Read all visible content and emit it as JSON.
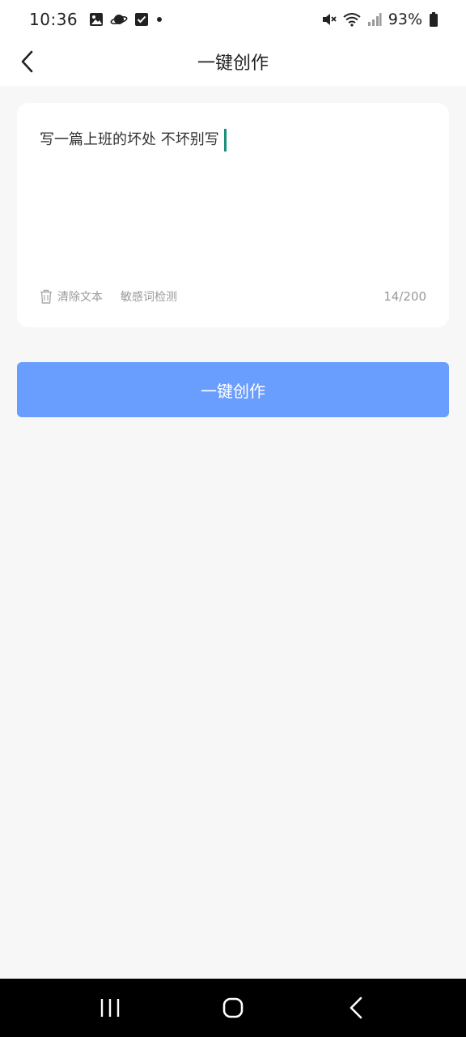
{
  "status_bar": {
    "time": "10:36",
    "battery": "93%"
  },
  "header": {
    "title": "一键创作"
  },
  "editor": {
    "text": "写一篇上班的坏处 不坏别写",
    "clear_label": "清除文本",
    "sensitive_check_label": "敏感词检测",
    "char_count": "14/200"
  },
  "actions": {
    "create_label": "一键创作"
  },
  "colors": {
    "accent": "#6a9efe",
    "cursor": "#18907a",
    "background": "#f7f7f7"
  }
}
